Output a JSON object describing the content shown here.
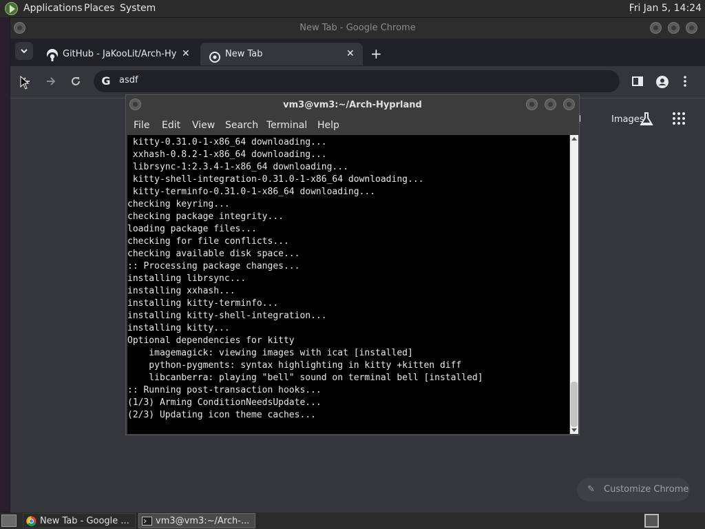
{
  "top_panel": {
    "menus": [
      "Applications",
      "Places",
      "System"
    ],
    "clock": "Fri Jan  5, 14:24"
  },
  "chrome": {
    "window_title": "New Tab - Google Chrome",
    "tabs": [
      {
        "label": "GitHub - JaKooLit/Arch-Hyprl",
        "close": "✕"
      },
      {
        "label": "New Tab",
        "close": "✕"
      }
    ],
    "new_tab": "+",
    "omnibox_value": "asdf",
    "omnibox_icon": "G",
    "ntp_gmail_fragment": "il",
    "ntp_images": "Images",
    "customize_label": "Customize Chrome",
    "icons": {
      "back": "back-arrow-icon",
      "forward": "forward-arrow-icon",
      "reload": "reload-icon",
      "side_panel": "side-panel-icon",
      "profile": "profile-icon",
      "menu": "kebab-menu-icon"
    }
  },
  "terminal": {
    "title": "vm3@vm3:~/Arch-Hyprland",
    "menu": [
      "File",
      "Edit",
      "View",
      "Search",
      "Terminal",
      "Help"
    ],
    "lines": [
      " kitty-0.31.0-1-x86_64 downloading...",
      " xxhash-0.8.2-1-x86_64 downloading...",
      " librsync-1:2.3.4-1-x86_64 downloading...",
      " kitty-shell-integration-0.31.0-1-x86_64 downloading...",
      " kitty-terminfo-0.31.0-1-x86_64 downloading...",
      "checking keyring...",
      "checking package integrity...",
      "loading package files...",
      "checking for file conflicts...",
      "checking available disk space...",
      ":: Processing package changes...",
      "installing librsync...",
      "installing xxhash...",
      "installing kitty-terminfo...",
      "installing kitty-shell-integration...",
      "installing kitty...",
      "Optional dependencies for kitty",
      "    imagemagick: viewing images with icat [installed]",
      "    python-pygments: syntax highlighting in kitty +kitten diff",
      "    libcanberra: playing \"bell\" sound on terminal bell [installed]",
      ":: Running post-transaction hooks...",
      "(1/3) Arming ConditionNeedsUpdate...",
      "(2/3) Updating icon theme caches..."
    ]
  },
  "taskbar": {
    "tasks": [
      "New Tab - Google ...",
      "vm3@vm3:~/Arch-..."
    ]
  },
  "colors": {
    "chrome_bg": "#35363a",
    "tabstrip_bg": "#202124",
    "terminal_bg": "#000000",
    "panel_bg": "#2b2b2b"
  }
}
